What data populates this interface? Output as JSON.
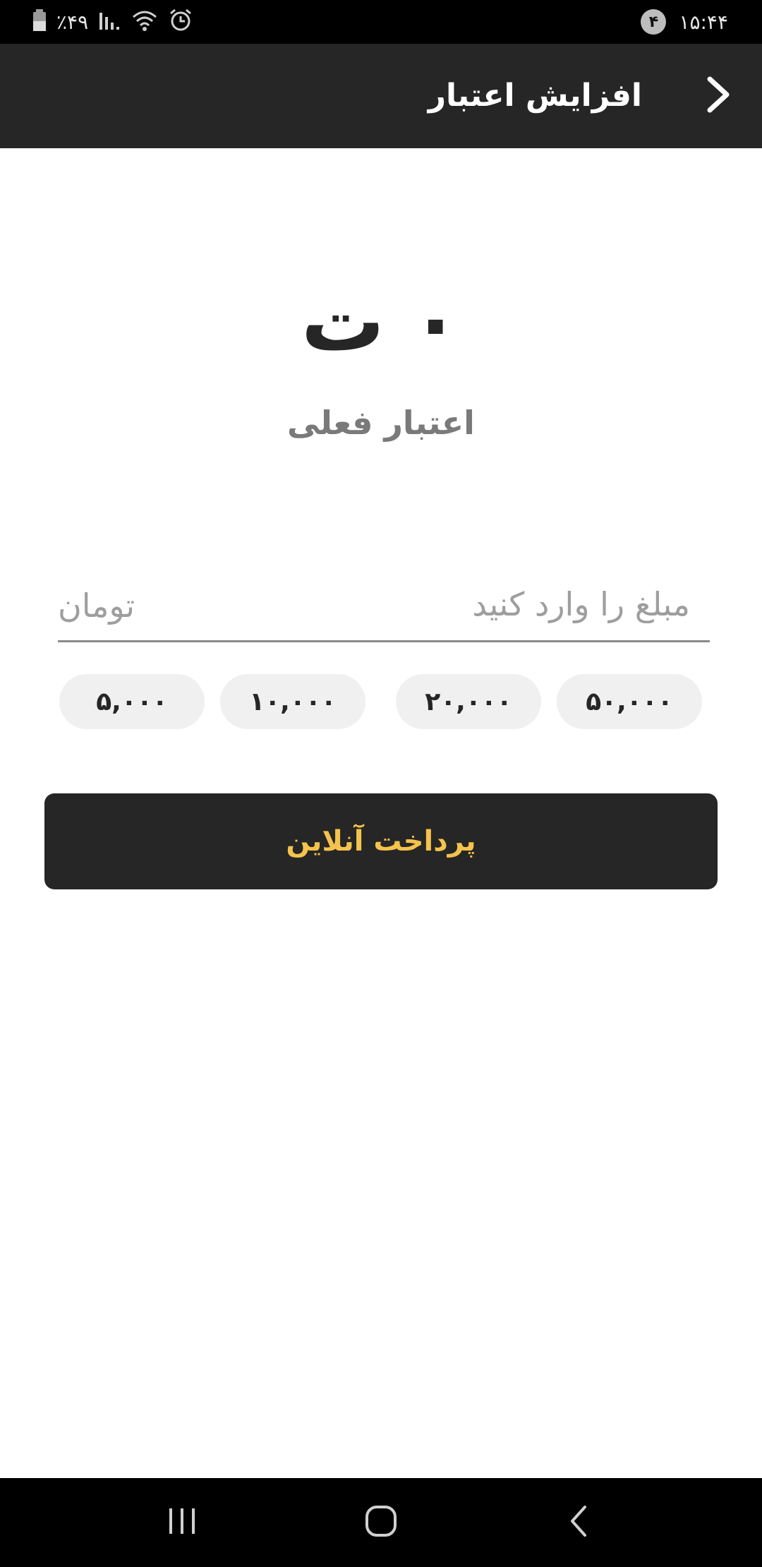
{
  "status_bar": {
    "time": "۱۵:۴۴",
    "notification_count": "۴",
    "battery": "٪۴۹"
  },
  "toolbar": {
    "title": "افزایش اعتبار"
  },
  "balance": {
    "amount": "۰",
    "currency": "ت",
    "caption": "اعتبار فعلی"
  },
  "amount_input": {
    "value": "",
    "placeholder": "مبلغ را وارد کنید",
    "unit": "تومان"
  },
  "quick_amounts": [
    "۵۰,۰۰۰",
    "۲۰,۰۰۰",
    "۱۰,۰۰۰",
    "۵,۰۰۰"
  ],
  "pay_button": {
    "label": "پرداخت آنلاین"
  },
  "colors": {
    "toolbar_bg": "#262626",
    "pay_label": "#f5c34c",
    "chip_bg": "#f0f0f0"
  }
}
